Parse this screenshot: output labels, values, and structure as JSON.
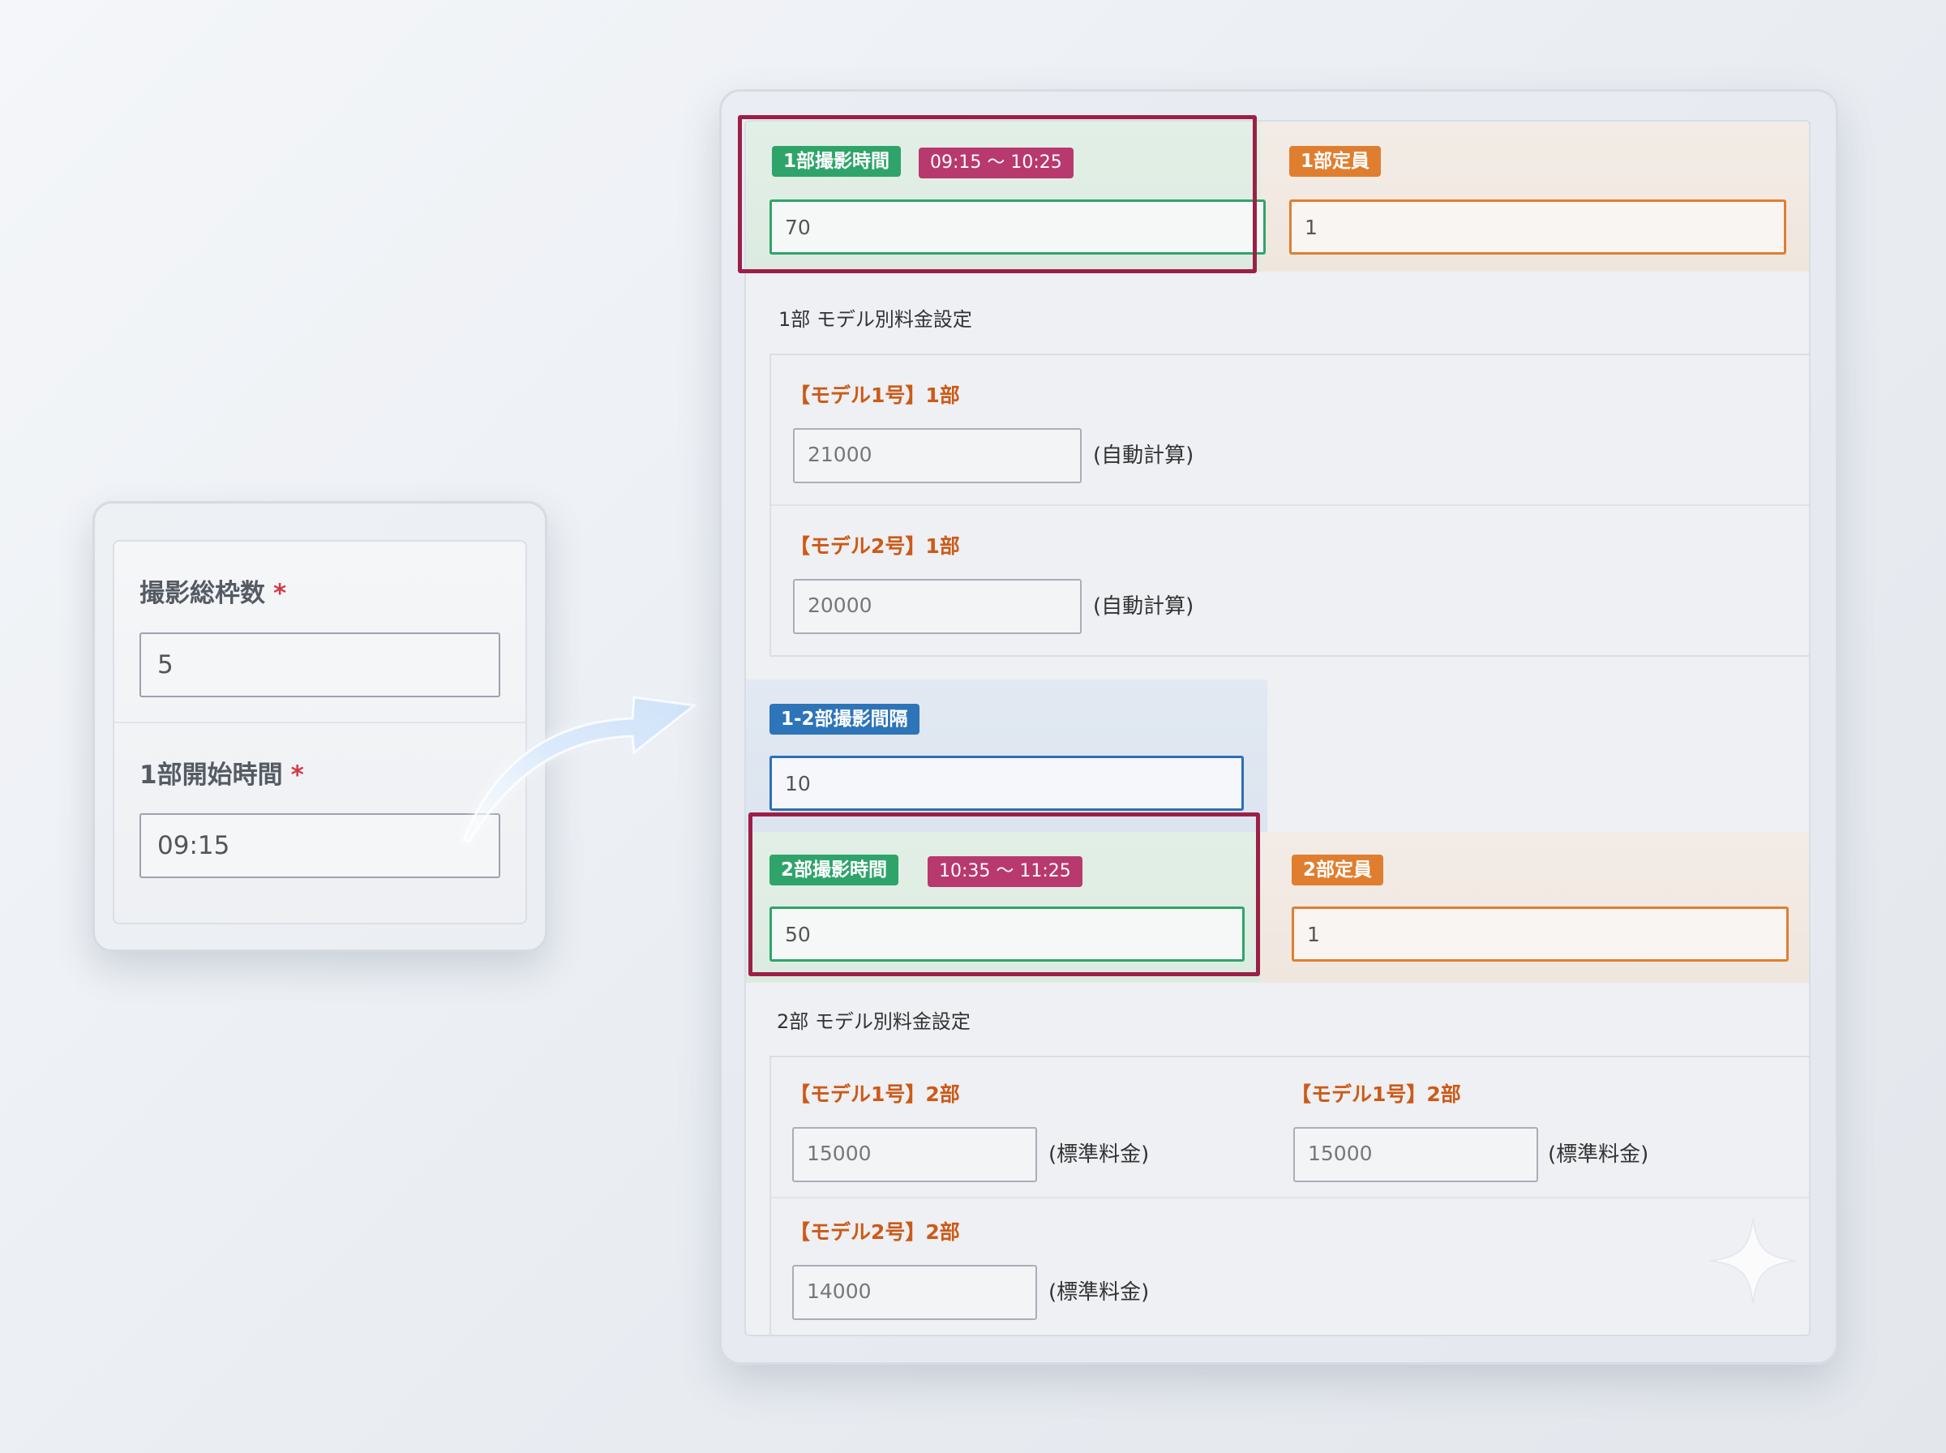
{
  "left_form": {
    "total_slots": {
      "label": "撮影総枠数",
      "required_mark": "*",
      "value": "5"
    },
    "start_time": {
      "label": "1部開始時間",
      "required_mark": "*",
      "value": "09:15"
    }
  },
  "part1": {
    "time_badge": "1部撮影時間",
    "time_range": "09:15 〜 10:25",
    "time_value": "70",
    "capacity_badge": "1部定員",
    "capacity_value": "1",
    "pricing_title": "1部 モデル別料金設定",
    "models": [
      {
        "label": "【モデル1号】1部",
        "value": "21000",
        "note": "(自動計算)"
      },
      {
        "label": "【モデル2号】1部",
        "value": "20000",
        "note": "(自動計算)"
      }
    ]
  },
  "interval": {
    "badge": "1-2部撮影間隔",
    "value": "10"
  },
  "part2": {
    "time_badge": "2部撮影時間",
    "time_range": "10:35 〜 11:25",
    "time_value": "50",
    "capacity_badge": "2部定員",
    "capacity_value": "1",
    "pricing_title": "2部 モデル別料金設定",
    "models": [
      {
        "label": "【モデル1号】2部",
        "value": "15000",
        "note": "(標準料金)"
      },
      {
        "label": "【モデル1号】2部",
        "value": "15000",
        "note": "(標準料金)"
      },
      {
        "label": "【モデル2号】2部",
        "value": "14000",
        "note": "(標準料金)"
      }
    ]
  },
  "colors": {
    "green": "#2fa46a",
    "magenta": "#b8396e",
    "orange": "#e07e30",
    "blue": "#2d74b8",
    "highlight": "#9c1f46",
    "model_label": "#cc5a18",
    "required": "#d23a48"
  },
  "icons": [
    "curved-arrow-icon",
    "sparkle-icon"
  ]
}
